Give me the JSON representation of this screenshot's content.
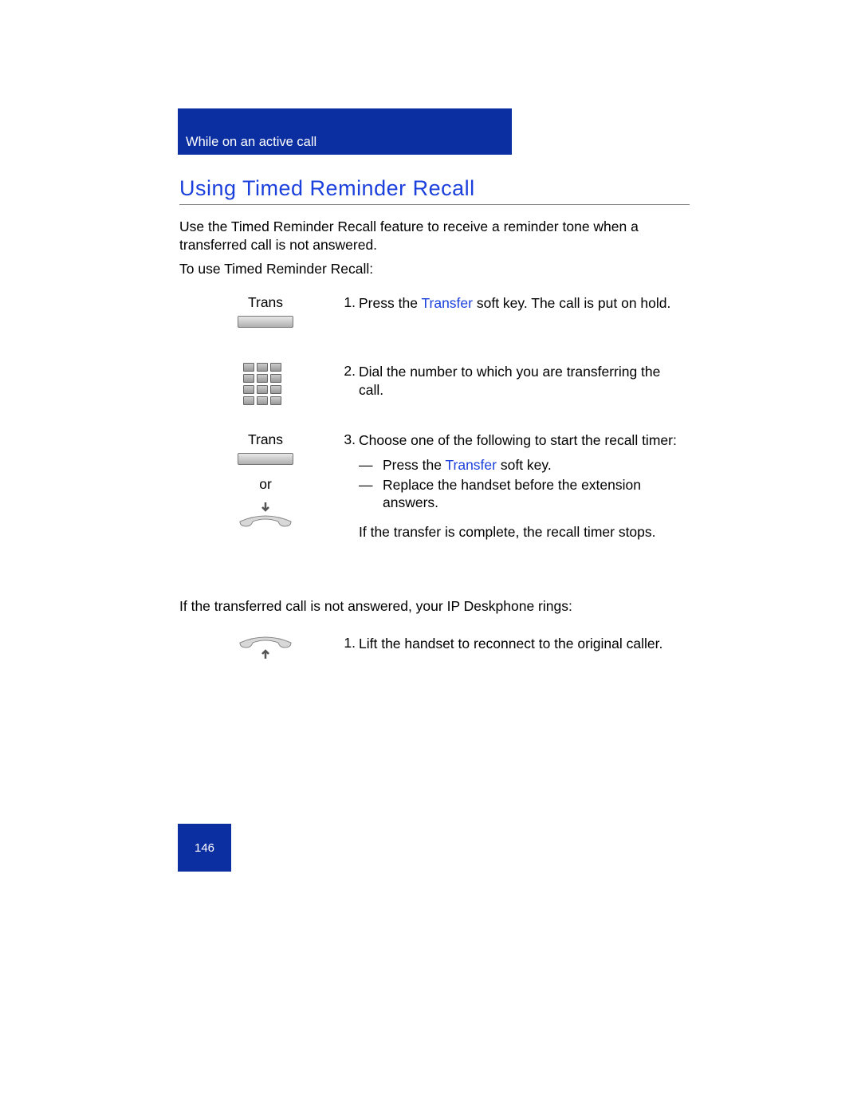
{
  "header": "While on an active call",
  "title": "Using Timed Reminder Recall",
  "intro": "Use the Timed Reminder Recall feature to receive a reminder tone when a transferred call is not answered.",
  "intro2": "To use Timed Reminder Recall:",
  "labels": {
    "trans": "Trans",
    "or": "or"
  },
  "steps": {
    "s1_num": "1.",
    "s1a": "Press the ",
    "s1_link": "Transfer",
    "s1b": " soft key. The call is put on hold.",
    "s2_num": "2.",
    "s2": "Dial the number to which you are transferring the call.",
    "s3_num": "3.",
    "s3": "Choose one of the following to start the recall timer:",
    "s3_b1a": "Press the ",
    "s3_b1_link": "Transfer",
    "s3_b1b": " soft key.",
    "s3_b2": "Replace the handset before the extension answers.",
    "s3_tail": "If the transfer is complete, the recall timer stops."
  },
  "mid": "If the transferred call is not answered, your IP Deskphone rings:",
  "steps2": {
    "s1_num": "1.",
    "s1": "Lift the handset to reconnect to the original caller."
  },
  "page_num": "146"
}
